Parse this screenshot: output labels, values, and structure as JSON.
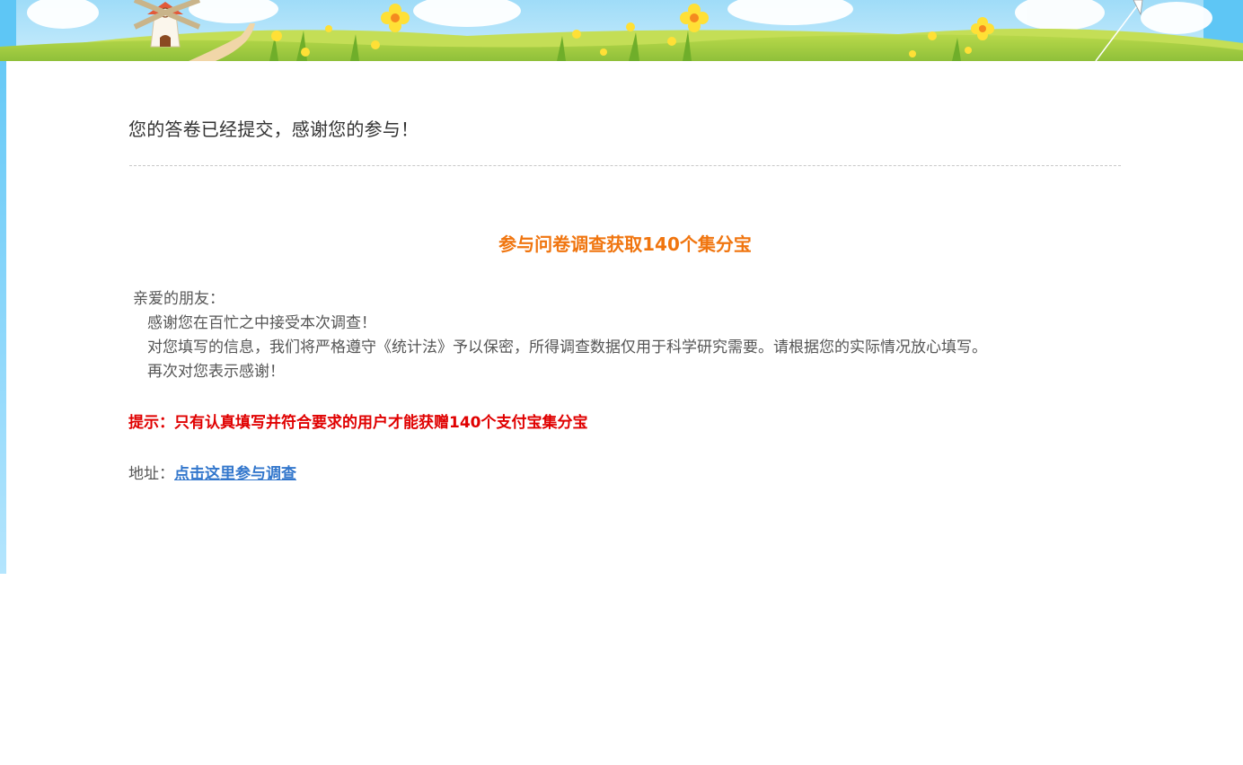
{
  "survey": {
    "submitted_message": "您的答卷已经提交，感谢您的参与！",
    "promo_title": "参与问卷调查获取140个集分宝",
    "letter": {
      "greeting": "亲爱的朋友：",
      "line1": "感谢您在百忙之中接受本次调查！",
      "line2": "对您填写的信息，我们将严格遵守《统计法》予以保密，所得调查数据仅用于科学研究需要。请根据您的实际情况放心填写。",
      "line3": "再次对您表示感谢！"
    },
    "tip": "提示：只有认真填写并符合要求的用户才能获赠140个支付宝集分宝",
    "address_label": "地址：",
    "address_link": "点击这里参与调查"
  },
  "colors": {
    "promo_title": "#f0750f",
    "tip": "#e00000",
    "link": "#3377cc",
    "sky": "#5ec6f5",
    "grass": "#9ccc3a"
  },
  "icons": {
    "banner_windmill": "windmill-icon",
    "banner_flowers": "flower-icon"
  }
}
